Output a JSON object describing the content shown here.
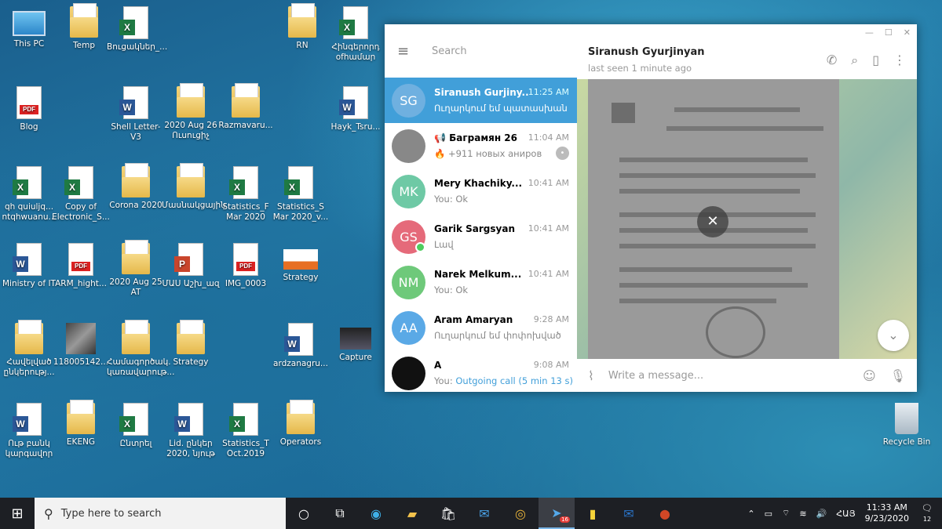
{
  "desktop": {
    "icons": [
      {
        "label": "This PC",
        "type": "pc",
        "icon": "computer-icon"
      },
      {
        "label": "Temp",
        "type": "folder",
        "icon": "folder-icon"
      },
      {
        "label": "Bnւցակներ_...",
        "type": "xls",
        "icon": "excel-icon"
      },
      {
        "label": "Blog",
        "type": "pdf",
        "icon": "pdf-folder-icon"
      },
      {
        "label": "Shell Letter-V3",
        "type": "word",
        "icon": "word-icon"
      },
      {
        "label": "2020 Aug 26 Ուսուցիչ",
        "type": "folder",
        "icon": "folder-icon"
      },
      {
        "label": "Razmavaru...",
        "type": "folder",
        "icon": "folder-icon"
      },
      {
        "label": "RN",
        "type": "folder",
        "icon": "folder-icon"
      },
      {
        "label": "Հինգերորդ ofհամար",
        "type": "xls",
        "icon": "excel-icon"
      },
      {
        "label": "Hayk_Tsru...",
        "type": "word",
        "icon": "word-icon"
      },
      {
        "label": "qh quiuljq... ntqhwuanu...",
        "type": "xls",
        "icon": "excel-icon"
      },
      {
        "label": "Copy of Electronic_S...",
        "type": "xls",
        "icon": "excel-icon"
      },
      {
        "label": "Corona 2020",
        "type": "folder",
        "icon": "folder-icon"
      },
      {
        "label": "Մասնակցային",
        "type": "folder",
        "icon": "folder-icon"
      },
      {
        "label": "Statistics_F Mar 2020",
        "type": "xls",
        "icon": "excel-icon"
      },
      {
        "label": "Statistics_S Mar 2020_v...",
        "type": "xls",
        "icon": "excel-icon"
      },
      {
        "label": "Ministry of IT",
        "type": "word",
        "icon": "word-icon"
      },
      {
        "label": "ARM_hight...",
        "type": "pdf",
        "icon": "pdf-icon"
      },
      {
        "label": "2020 Aug 25 AT",
        "type": "folder",
        "icon": "folder-icon"
      },
      {
        "label": "ՄԱՍ Աշխ_ազ",
        "type": "ppt",
        "icon": "powerpoint-icon"
      },
      {
        "label": "IMG_0003",
        "type": "pdf",
        "icon": "pdf-icon"
      },
      {
        "label": "Strategy",
        "type": "strat",
        "icon": "image-icon"
      },
      {
        "label": "Հավելված ընկերությ...",
        "type": "folder",
        "icon": "folder-icon"
      },
      {
        "label": "118005142...",
        "type": "img",
        "icon": "image-icon"
      },
      {
        "label": "Համագործակ. կառավարութ...",
        "type": "folder",
        "icon": "folder-icon"
      },
      {
        "label": "Strategy",
        "type": "folder",
        "icon": "folder-icon"
      },
      {
        "label": "ardzanagru...",
        "type": "word",
        "icon": "word-icon"
      },
      {
        "label": "Capture",
        "type": "capture",
        "icon": "image-icon"
      },
      {
        "label": "Ութ բանկ կարգավոր",
        "type": "word",
        "icon": "word-icon"
      },
      {
        "label": "EKENG",
        "type": "folder",
        "icon": "folder-icon"
      },
      {
        "label": "Ընտրել",
        "type": "xls",
        "icon": "excel-icon"
      },
      {
        "label": "Lid. ընկեր 2020, նյութ",
        "type": "word",
        "icon": "word-icon"
      },
      {
        "label": "Statistics_T Oct.2019",
        "type": "xls",
        "icon": "excel-icon"
      },
      {
        "label": "Operators",
        "type": "folder",
        "icon": "folder-icon"
      },
      {
        "label": "Recycle Bin",
        "type": "bin",
        "icon": "recycle-bin-icon"
      }
    ]
  },
  "telegram": {
    "search_placeholder": "Search",
    "chat_title": "Siranush Gyurjinyan",
    "chat_status": "last seen 1 minute ago",
    "compose_placeholder": "Write a message...",
    "chats": [
      {
        "initials": "SG",
        "name": "Siranush Gurjiny...",
        "time": "11:25 AM",
        "msg": "Ուղարկում եմ պատասխան",
        "color": "#6fb0e0",
        "active": true
      },
      {
        "initials": "",
        "name": "📢 Баграмян 26",
        "time": "11:04 AM",
        "msg": "🔥 +911 новых аниров",
        "color": "#888",
        "active": false,
        "unread": "•"
      },
      {
        "initials": "MK",
        "name": "Mery Khachiky...",
        "time": "10:41 AM",
        "msg": "You: Ok",
        "color": "#6ec9a5",
        "active": false
      },
      {
        "initials": "GS",
        "name": "Garik Sargsyan",
        "time": "10:41 AM",
        "msg": "Լավ",
        "color": "#e56a7a",
        "active": false,
        "online": true
      },
      {
        "initials": "NM",
        "name": "Narek Melkum...",
        "time": "10:41 AM",
        "msg": "You: Ok",
        "color": "#6ec97a",
        "active": false
      },
      {
        "initials": "AA",
        "name": "Aram Amaryan",
        "time": "9:28 AM",
        "msg": "Ուղարկում եմ փոփոխված",
        "color": "#5aa9e6",
        "active": false
      },
      {
        "initials": "",
        "name": "A",
        "time": "9:08 AM",
        "msg_prefix": "You: ",
        "msg": "Outgoing call (5 min 13 s)",
        "color": "#111",
        "active": false
      }
    ]
  },
  "taskbar": {
    "search_placeholder": "Type here to search",
    "lang": "ՀԱՅ",
    "time": "11:33 AM",
    "date": "9/23/2020",
    "notif_count": "12",
    "telegram_badge": "16"
  }
}
